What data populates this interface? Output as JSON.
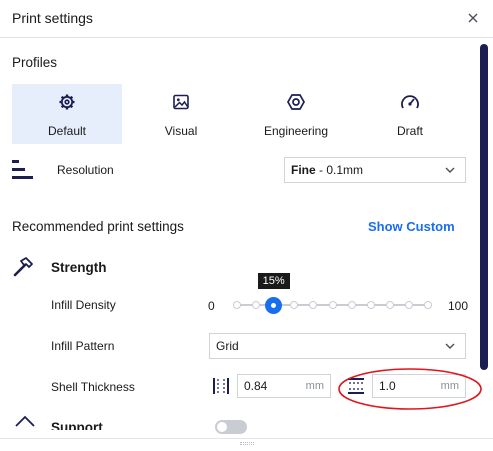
{
  "window": {
    "title": "Print settings"
  },
  "profiles": {
    "title": "Profiles",
    "items": [
      {
        "label": "Default",
        "icon": "gear-icon",
        "active": true
      },
      {
        "label": "Visual",
        "icon": "image-icon",
        "active": false
      },
      {
        "label": "Engineering",
        "icon": "hex-nut-icon",
        "active": false
      },
      {
        "label": "Draft",
        "icon": "speedometer-icon",
        "active": false
      }
    ]
  },
  "resolution": {
    "label": "Resolution",
    "value_bold": "Fine",
    "value_rest": " - 0.1mm"
  },
  "recommended": {
    "title": "Recommended print settings",
    "show_custom": "Show Custom"
  },
  "strength": {
    "title": "Strength",
    "infill_density": {
      "label": "Infill Density",
      "min": "0",
      "max": "100",
      "value_label": "15%",
      "value": 15
    },
    "infill_pattern": {
      "label": "Infill Pattern",
      "value": "Grid"
    },
    "shell_thickness": {
      "label": "Shell Thickness",
      "wall_value": "0.84",
      "wall_unit": "mm",
      "top_bottom_value": "1.0",
      "top_bottom_unit": "mm"
    }
  },
  "support": {
    "title": "Support",
    "enabled": false
  },
  "annotation": {
    "color": "#e0151b"
  },
  "colors": {
    "accent": "#196ef0",
    "scrollbar": "#1b1e52",
    "selected_bg": "#e6eefc"
  }
}
